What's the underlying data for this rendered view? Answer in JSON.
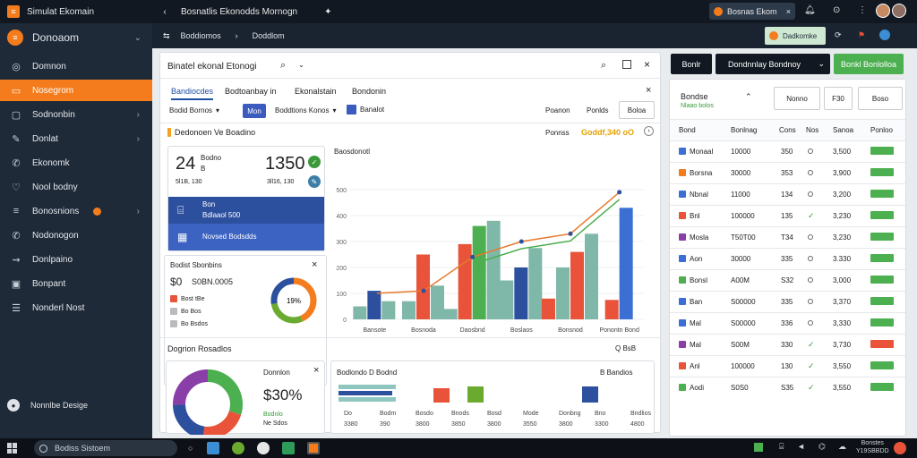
{
  "app": {
    "window_title": "Simulat Ekomain",
    "brand": "Donoaom",
    "top_title": "Bosnatlis Ekonodds Mornogn",
    "top_tab": "Bosnas Ekom",
    "sub_crumb_1": "Boddiomos",
    "sub_crumb_2": "Doddlom",
    "sub_chip": "Dadkomke"
  },
  "sidebar": {
    "items": [
      {
        "label": "Domnon",
        "icon": "person-icon"
      },
      {
        "label": "Nosegrom",
        "icon": "inbox-icon"
      },
      {
        "label": "Sodnonbin",
        "icon": "folder-icon"
      },
      {
        "label": "Donlat",
        "icon": "pen-icon"
      },
      {
        "label": "Ekonomk",
        "icon": "chat-icon"
      },
      {
        "label": "Nool bodny",
        "icon": "heart-icon"
      },
      {
        "label": "Bonosnions",
        "icon": "layers-icon"
      },
      {
        "label": "Nodonogon",
        "icon": "pin-icon"
      },
      {
        "label": "Donlpaino",
        "icon": "share-icon"
      },
      {
        "label": "Bonpant",
        "icon": "box-icon"
      },
      {
        "label": "Nonderl Nost",
        "icon": "list-icon"
      }
    ],
    "footer": "Nonnlbe Desige"
  },
  "main": {
    "title": "Binatel ekonal Etonogi",
    "tabs": [
      "Bandiocdes",
      "Bodtoanbay in",
      "Ekonalstain",
      "Bondonin"
    ],
    "filters": {
      "f1": "Bodid Bornos",
      "f2": "Mon",
      "f3": "Boddtions Konos",
      "f4": "Banalot"
    },
    "right_btns": [
      "Poanon",
      "Ponlds",
      "Boloa"
    ],
    "section_title": "Dedonoen Ve Boadino",
    "section_right_label": "Ponnss",
    "section_right_value": "Goddf,340 oO",
    "stat": {
      "left_value": "24",
      "left_label": "Bodno",
      "left_sub": "B",
      "left_small": "5l1B, 130",
      "right_value": "1350",
      "right_small": "3ll16, 130"
    },
    "blue_rows": [
      {
        "icon": "chart-icon",
        "label": "Bon",
        "sub": "Bdlaaol 500"
      },
      {
        "icon": "grid-icon",
        "label": "Novsed Bodsdds"
      }
    ],
    "donut_panel": {
      "title": "Bodist Sbonbins",
      "value": "$0",
      "value2": "S0BN.0005",
      "items": [
        "Bost tBe",
        "Bo Bos",
        "Bo Bsdos"
      ],
      "center": "19%"
    },
    "chart_title": "Baosdonotl",
    "chart_bottom_labels": [
      "Bansote",
      "Bosnoda",
      "Daosbnd",
      "Boslaos",
      "Bonsnod",
      "Ponontn Bond"
    ],
    "bottom_title": "Dogrion Rosadlos",
    "bottom_right_label": "Q BsB",
    "bottom_left": {
      "label": "Donnlon",
      "value": "$30%",
      "badge": "Bodnlo",
      "sub": "Ne Sdos"
    },
    "bottom_right_title": "Bodlondo D Bodnd",
    "bottom_right_side": "B Bandios",
    "bottom_axis": [
      "Do",
      "Bodm",
      "Bosdo",
      "Bnods",
      "Bosd",
      "Mode",
      "Donbng",
      "Bno",
      "Bndlios"
    ],
    "bottom_axis_vals": [
      "3380",
      "390",
      "3800",
      "3850",
      "3800",
      "3550",
      "3800",
      "3300",
      "4800"
    ]
  },
  "right_panel": {
    "btn_dark": "Bonlr",
    "btn_dropdown": "Dondnnlay Bondnoy",
    "btn_green": "Bonkl Bonlolloa",
    "header_title": "Bondse",
    "header_sub": "Nlaao bolos",
    "header_btns": [
      "Nonno",
      "F30",
      "Boso"
    ],
    "columns": [
      "Bond",
      "Bonlnag",
      "Cons",
      "Nos",
      "Sanoa",
      "Ponloo"
    ],
    "rows": [
      {
        "color": "#3b6fd4",
        "name": "Monaal",
        "val": "10000",
        "num": "350",
        "status": "o",
        "amt": "3,500",
        "badge": "green"
      },
      {
        "color": "#f47c1c",
        "name": "Borsna",
        "val": "30000",
        "num": "353",
        "status": "o",
        "amt": "3,900",
        "badge": "green"
      },
      {
        "color": "#3b6fd4",
        "name": "Nbnal",
        "val": "11000",
        "num": "134",
        "status": "o",
        "amt": "3,200",
        "badge": "green"
      },
      {
        "color": "#e8533a",
        "name": "Bnl",
        "val": "100000",
        "num": "135",
        "status": "check",
        "amt": "3,230",
        "badge": "green"
      },
      {
        "color": "#8a3ea8",
        "name": "Mosla",
        "val": "T50T00",
        "num": "T34",
        "status": "o",
        "amt": "3,230",
        "badge": "green"
      },
      {
        "color": "#3b6fd4",
        "name": "Aon",
        "val": "30000",
        "num": "335",
        "status": "o",
        "amt": "3.330",
        "badge": "green"
      },
      {
        "color": "#4caf50",
        "name": "Bonsl",
        "val": "A00M",
        "num": "S32",
        "status": "o",
        "amt": "3,000",
        "badge": "green"
      },
      {
        "color": "#3b6fd4",
        "name": "Ban",
        "val": "S00000",
        "num": "335",
        "status": "o",
        "amt": "3,370",
        "badge": "green"
      },
      {
        "color": "#3b6fd4",
        "name": "Mal",
        "val": "S00000",
        "num": "336",
        "status": "o",
        "amt": "3,330",
        "badge": "green"
      },
      {
        "color": "#8a3ea8",
        "name": "Mal",
        "val": "S00M",
        "num": "330",
        "status": "check",
        "amt": "3,730",
        "badge": "red"
      },
      {
        "color": "#e8533a",
        "name": "Anl",
        "val": "100000",
        "num": "130",
        "status": "check",
        "amt": "3,550",
        "badge": "green"
      },
      {
        "color": "#4caf50",
        "name": "Aodi",
        "val": "S0S0",
        "num": "S35",
        "status": "check",
        "amt": "3,550",
        "badge": "green"
      }
    ]
  },
  "taskbar": {
    "search": "Bodiss Sistoem",
    "time": "Bonstes",
    "date": "Y19SBBDD"
  },
  "chart_data": {
    "type": "bar",
    "categories": [
      "Bansote",
      "Bosnoda",
      "Daosbnd",
      "Boslaos",
      "Bonsnod",
      "Ponontn Bond"
    ],
    "ylim": [
      0,
      600
    ],
    "yticks": [
      0,
      100,
      200,
      300,
      400,
      500
    ],
    "series": [
      {
        "values": [
          50,
          70,
          40,
          150,
          80,
          75
        ]
      },
      {
        "values": [
          110,
          250,
          290,
          200,
          200,
          430
        ]
      },
      {
        "values": [
          70,
          130,
          360,
          275,
          260,
          0
        ]
      },
      {
        "values": [
          0,
          0,
          380,
          0,
          0,
          0
        ]
      },
      {
        "values": [
          0,
          0,
          0,
          0,
          330,
          0
        ]
      }
    ],
    "line": [
      [
        0,
        100
      ],
      [
        1,
        110
      ],
      [
        2,
        240
      ],
      [
        3,
        300
      ],
      [
        4,
        330
      ],
      [
        5,
        490
      ]
    ]
  }
}
